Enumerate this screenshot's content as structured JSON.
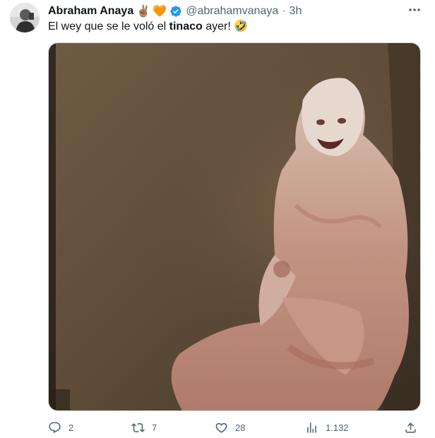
{
  "author": {
    "display_name": "Abraham Anaya",
    "badge_emoji_1": "✌🏽",
    "badge_emoji_2": "🧡",
    "verified_icon": "verified-badge-icon",
    "handle": "@abrahamvanaya",
    "separator": "·",
    "time": "3h"
  },
  "tweet": {
    "text_before": "El wey que se le voló el ",
    "text_bold": "tinaco",
    "text_after": " ayer! ",
    "emoji": "🤣"
  },
  "actions": {
    "replies": "2",
    "reposts": "7",
    "likes": "28",
    "views": "1.132"
  },
  "icons": {
    "more": "more-icon",
    "reply": "reply-icon",
    "repost": "repost-icon",
    "like": "like-icon",
    "views": "views-icon",
    "share": "share-icon"
  },
  "colors": {
    "text_primary": "#0f1419",
    "text_secondary": "#536471",
    "verified": "#1d9bf0",
    "border": "#cfd9de"
  }
}
